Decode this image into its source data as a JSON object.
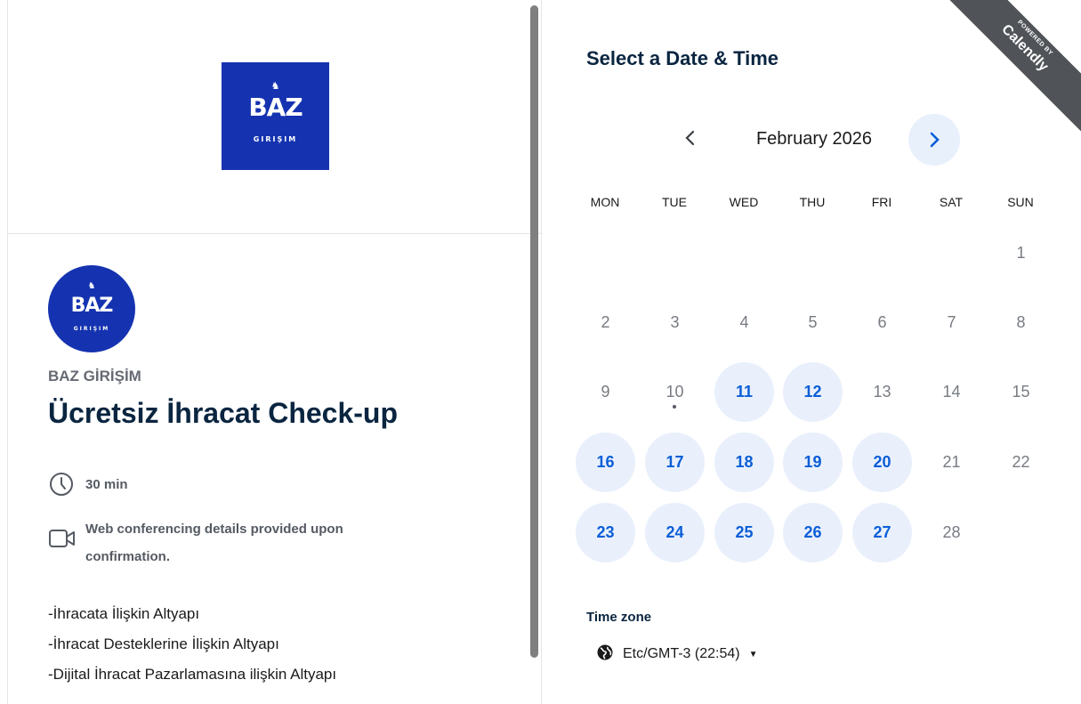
{
  "brand": {
    "logo_wordmark": "BAZ",
    "logo_subtitle": "GIRIŞIM"
  },
  "event": {
    "organizer": "BAZ GİRİŞİM",
    "title": "Ücretsiz İhracat Check-up",
    "duration": "30 min",
    "conferencing_line1": "Web conferencing details provided upon",
    "conferencing_line2": "confirmation.",
    "description": [
      "-İhracata İlişkin Altyapı",
      "-İhracat Desteklerine İlişkin Altyapı",
      "-Dijital İhracat Pazarlamasına ilişkin Altyapı"
    ]
  },
  "scheduler": {
    "heading": "Select a Date & Time",
    "ribbon_top": "POWERED BY",
    "ribbon_brand": "Calendly",
    "month": "February 2026",
    "weekdays": [
      "MON",
      "TUE",
      "WED",
      "THU",
      "FRI",
      "SAT",
      "SUN"
    ],
    "days": [
      {
        "label": "1",
        "available": false
      },
      {
        "label": "2",
        "available": false
      },
      {
        "label": "3",
        "available": false
      },
      {
        "label": "4",
        "available": false
      },
      {
        "label": "5",
        "available": false
      },
      {
        "label": "6",
        "available": false
      },
      {
        "label": "7",
        "available": false
      },
      {
        "label": "8",
        "available": false
      },
      {
        "label": "9",
        "available": false
      },
      {
        "label": "10",
        "available": false,
        "today": true
      },
      {
        "label": "11",
        "available": true
      },
      {
        "label": "12",
        "available": true
      },
      {
        "label": "13",
        "available": false
      },
      {
        "label": "14",
        "available": false
      },
      {
        "label": "15",
        "available": false
      },
      {
        "label": "16",
        "available": true
      },
      {
        "label": "17",
        "available": true
      },
      {
        "label": "18",
        "available": true
      },
      {
        "label": "19",
        "available": true
      },
      {
        "label": "20",
        "available": true
      },
      {
        "label": "21",
        "available": false
      },
      {
        "label": "22",
        "available": false
      },
      {
        "label": "23",
        "available": true
      },
      {
        "label": "24",
        "available": true
      },
      {
        "label": "25",
        "available": true
      },
      {
        "label": "26",
        "available": true
      },
      {
        "label": "27",
        "available": true
      },
      {
        "label": "28",
        "available": false
      }
    ],
    "timezone_label": "Time zone",
    "timezone_value": "Etc/GMT-3 (22:54)"
  },
  "colors": {
    "brand_blue": "#1533b0",
    "accent": "#0b5ed7",
    "available_bg": "#e9f0fc",
    "ribbon": "#505357"
  },
  "icons": [
    "clock-icon",
    "video-camera-icon",
    "globe-icon",
    "chevron-left-icon",
    "chevron-right-icon",
    "caret-down-icon",
    "crown-icon"
  ]
}
